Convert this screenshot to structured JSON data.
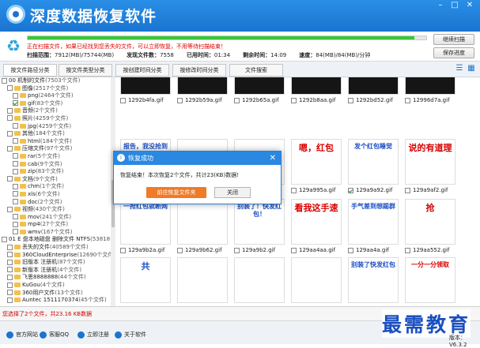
{
  "app": {
    "title": "深度数据恢复软件",
    "version": "版本：V6.3.2"
  },
  "scan": {
    "progress": 0.97,
    "warning": "正在扫描文件，如果已经找到您丢失的文件，可以立即恢复，不用等待扫描结束！",
    "label_scanned": "扫描范围：",
    "scanned": "7912(MB)/75744(MB)",
    "label_found": "发现文件数：",
    "found": "7558",
    "label_elapsed": "已用时间：",
    "elapsed": "01:34",
    "label_remaining": "剩余时间：",
    "remaining": "14:09",
    "label_speed": "速度：",
    "speed": "84(MB)/84(MB)/分钟",
    "stop_label": "继续扫描",
    "save_label": "保存进度"
  },
  "tabs": [
    "按文件路径分类",
    "按文件类型分类",
    "按创建时间分类",
    "按修改时间分类",
    "文件搜索"
  ],
  "tree": [
    {
      "label": "00 机制的文件",
      "count": "(7503个文件)",
      "indent": 0,
      "checked": false,
      "folder": false
    },
    {
      "label": "图像",
      "count": "(2517个文件)",
      "indent": 1,
      "checked": false,
      "folder": true
    },
    {
      "label": "png",
      "count": "(2464个文件)",
      "indent": 2,
      "checked": false,
      "folder": true
    },
    {
      "label": "gif",
      "count": "(83个文件)",
      "indent": 2,
      "checked": true,
      "folder": true
    },
    {
      "label": "音频",
      "count": "(2个文件)",
      "indent": 1,
      "checked": false,
      "folder": true
    },
    {
      "label": "照片",
      "count": "(4259个文件)",
      "indent": 1,
      "checked": false,
      "folder": true
    },
    {
      "label": "jpg",
      "count": "(4259个文件)",
      "indent": 2,
      "checked": false,
      "folder": true
    },
    {
      "label": "其他",
      "count": "(184个文件)",
      "indent": 1,
      "checked": false,
      "folder": true
    },
    {
      "label": "html",
      "count": "(184个文件)",
      "indent": 2,
      "checked": false,
      "folder": true
    },
    {
      "label": "压缩文件",
      "count": "(97个文件)",
      "indent": 1,
      "checked": false,
      "folder": true
    },
    {
      "label": "rar",
      "count": "(5个文件)",
      "indent": 2,
      "checked": false,
      "folder": true
    },
    {
      "label": "cab",
      "count": "(9个文件)",
      "indent": 2,
      "checked": false,
      "folder": true
    },
    {
      "label": "zip",
      "count": "(83个文件)",
      "indent": 2,
      "checked": false,
      "folder": true
    },
    {
      "label": "文档",
      "count": "(9个文件)",
      "indent": 1,
      "checked": false,
      "folder": true
    },
    {
      "label": "chm",
      "count": "(1个文件)",
      "indent": 2,
      "checked": false,
      "folder": true
    },
    {
      "label": "xls",
      "count": "(6个文件)",
      "indent": 2,
      "checked": false,
      "folder": true
    },
    {
      "label": "doc",
      "count": "(2个文件)",
      "indent": 2,
      "checked": false,
      "folder": true
    },
    {
      "label": "视频",
      "count": "(430个文件)",
      "indent": 1,
      "checked": false,
      "folder": true
    },
    {
      "label": "mov",
      "count": "(241个文件)",
      "indent": 2,
      "checked": false,
      "folder": true
    },
    {
      "label": "mp4",
      "count": "(27个文件)",
      "indent": 2,
      "checked": false,
      "folder": true
    },
    {
      "label": "wmv",
      "count": "(167个文件)",
      "indent": 2,
      "checked": false,
      "folder": true
    },
    {
      "label": "01 E 盘本地磁盘 删除文件 NTFS",
      "count": "(53818个文件)",
      "indent": 0,
      "checked": false,
      "folder": false
    },
    {
      "label": "丢失的文件",
      "count": "(40589个文件)",
      "indent": 1,
      "checked": false,
      "folder": true
    },
    {
      "label": "360CloudEnterprise",
      "count": "(12690个文件)",
      "indent": 1,
      "checked": false,
      "folder": true
    },
    {
      "label": "旧版本 注册机",
      "count": "(87个文件)",
      "indent": 1,
      "checked": false,
      "folder": true
    },
    {
      "label": "新版本 注册机",
      "count": "(4个文件)",
      "indent": 1,
      "checked": false,
      "folder": true
    },
    {
      "label": "飞思8888888",
      "count": "(44个文件)",
      "indent": 1,
      "checked": false,
      "folder": true
    },
    {
      "label": "KuGou",
      "count": "(4个文件)",
      "indent": 1,
      "checked": false,
      "folder": true
    },
    {
      "label": "360用户文件",
      "count": "(13个文件)",
      "indent": 1,
      "checked": false,
      "folder": true
    },
    {
      "label": "Auntec 1511170374",
      "count": "(45个文件)",
      "indent": 1,
      "checked": false,
      "folder": true
    }
  ],
  "files": [
    {
      "name": "1292b4fa.gif",
      "thumb": "dark",
      "text": "",
      "checked": false
    },
    {
      "name": "1292b59a.gif",
      "thumb": "dark",
      "text": "",
      "checked": false
    },
    {
      "name": "1292b65a.gif",
      "thumb": "dark",
      "text": "",
      "checked": false
    },
    {
      "name": "1292b8aa.gif",
      "thumb": "dark",
      "text": "",
      "checked": false
    },
    {
      "name": "1292bd52.gif",
      "thumb": "dark",
      "text": "",
      "checked": false
    },
    {
      "name": "12996d7a.gif",
      "thumb": "dark",
      "text": "",
      "checked": false
    },
    {
      "name": "",
      "thumb": "wx",
      "text": "报告，我没抢到",
      "checked": false
    },
    {
      "name": "",
      "thumb": "wx",
      "text": "",
      "checked": false
    },
    {
      "name": "",
      "thumb": "wx",
      "text": "",
      "checked": false
    },
    {
      "name": "129a995a.gif",
      "thumb": "wx",
      "text": "嗯，红包",
      "checked": false
    },
    {
      "name": "129a9a92.gif",
      "thumb": "wx",
      "text": "发个红包睡觉",
      "checked": true
    },
    {
      "name": "129a9af2.gif",
      "thumb": "wx",
      "text": "说的有道理",
      "checked": false
    },
    {
      "name": "129a9b2a.gif",
      "thumb": "wx",
      "text": "一抢红包就断网",
      "checked": false
    },
    {
      "name": "129a9b62.gif",
      "thumb": "wx",
      "text": "",
      "checked": false
    },
    {
      "name": "129a9b2.gif",
      "thumb": "wx",
      "text": "别装了！快发红包！",
      "checked": false
    },
    {
      "name": "129aa4aa.gif",
      "thumb": "wx",
      "text": "看我这手速",
      "checked": false
    },
    {
      "name": "129aa4a.gif",
      "thumb": "wx",
      "text": "手气差到想踢群",
      "checked": false
    },
    {
      "name": "129aa552.gif",
      "thumb": "wx",
      "text": "抢",
      "checked": false
    },
    {
      "name": "",
      "thumb": "wx",
      "text": "共",
      "checked": false
    },
    {
      "name": "",
      "thumb": "wx",
      "text": "",
      "checked": false
    },
    {
      "name": "",
      "thumb": "wx",
      "text": "",
      "checked": false
    },
    {
      "name": "",
      "thumb": "wx",
      "text": "",
      "checked": false
    },
    {
      "name": "",
      "thumb": "wx",
      "text": "别装了快发红包",
      "checked": false
    },
    {
      "name": "",
      "thumb": "wx",
      "text": "一分一分领取",
      "checked": false
    }
  ],
  "status": {
    "selected": "您选择了2个文件，共23.16 KB数据"
  },
  "footer": {
    "site": "官方网站",
    "qq": "客服QQ",
    "register": "立即注册",
    "about": "关于软件"
  },
  "watermark": "最需教育",
  "dialog": {
    "title": "恢复成功",
    "message": "恢复结束！本次恢复2个文件，共计23(KB)数据!",
    "open_button": "前往恢复文件夹",
    "close_button": "关闭"
  }
}
